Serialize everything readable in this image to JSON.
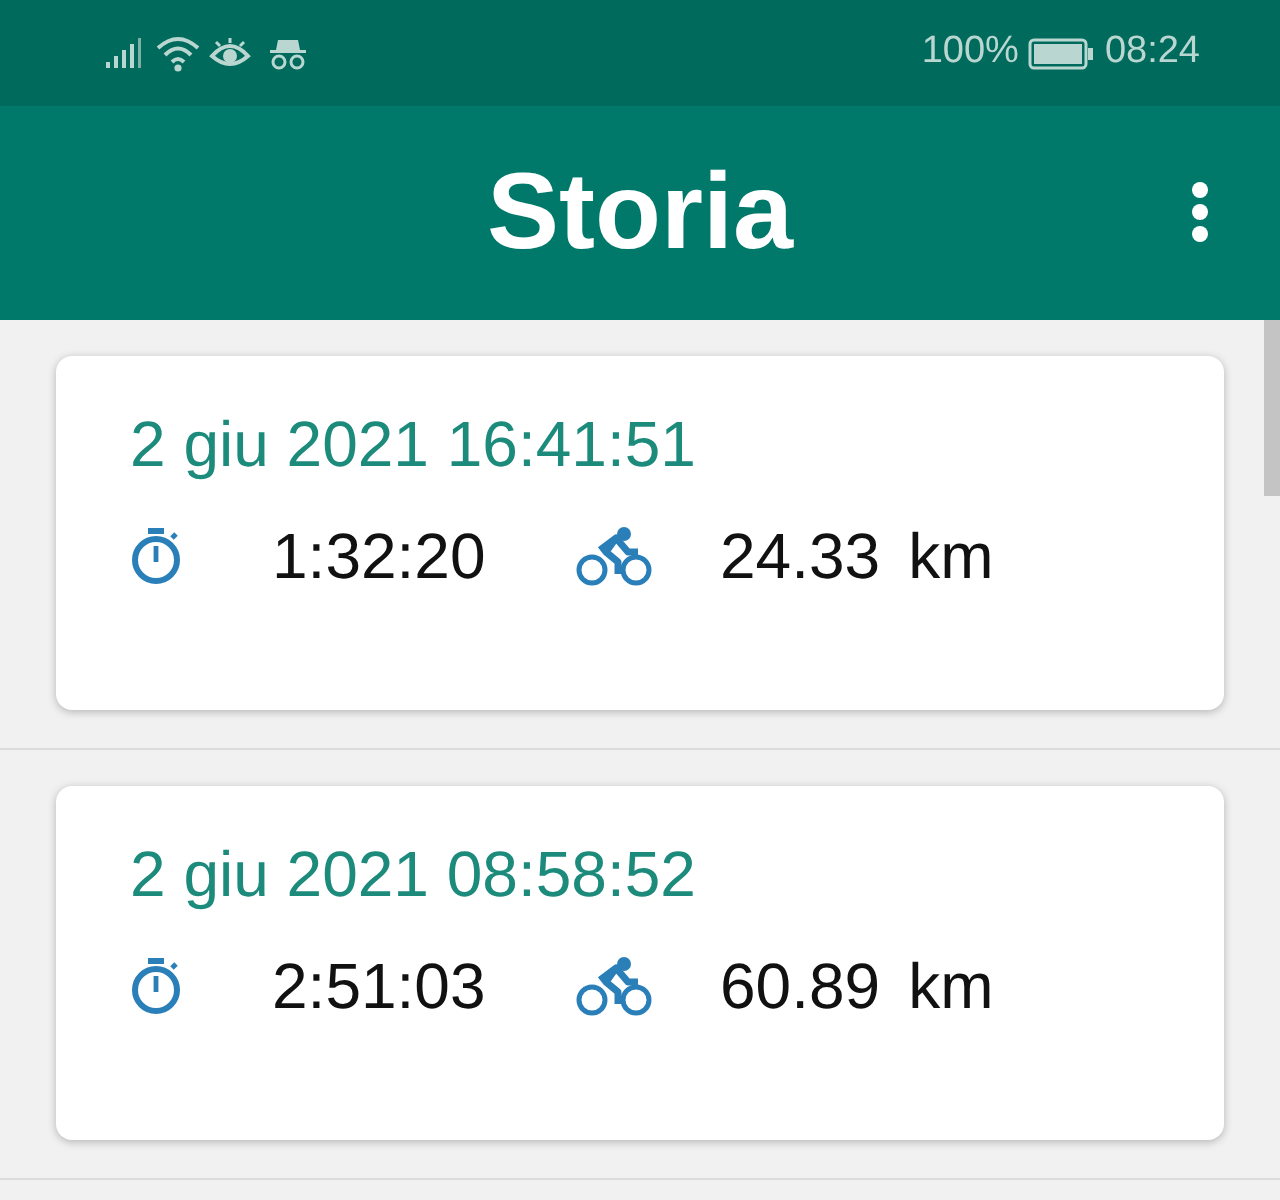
{
  "status_bar": {
    "battery": "100%",
    "time": "08:24"
  },
  "app_bar": {
    "title": "Storia"
  },
  "rides": [
    {
      "date": "2 giu 2021 16:41:51",
      "duration": "1:32:20",
      "distance": "24.33",
      "unit": "km"
    },
    {
      "date": "2 giu 2021 08:58:52",
      "duration": "2:51:03",
      "distance": "60.89",
      "unit": "km"
    }
  ]
}
